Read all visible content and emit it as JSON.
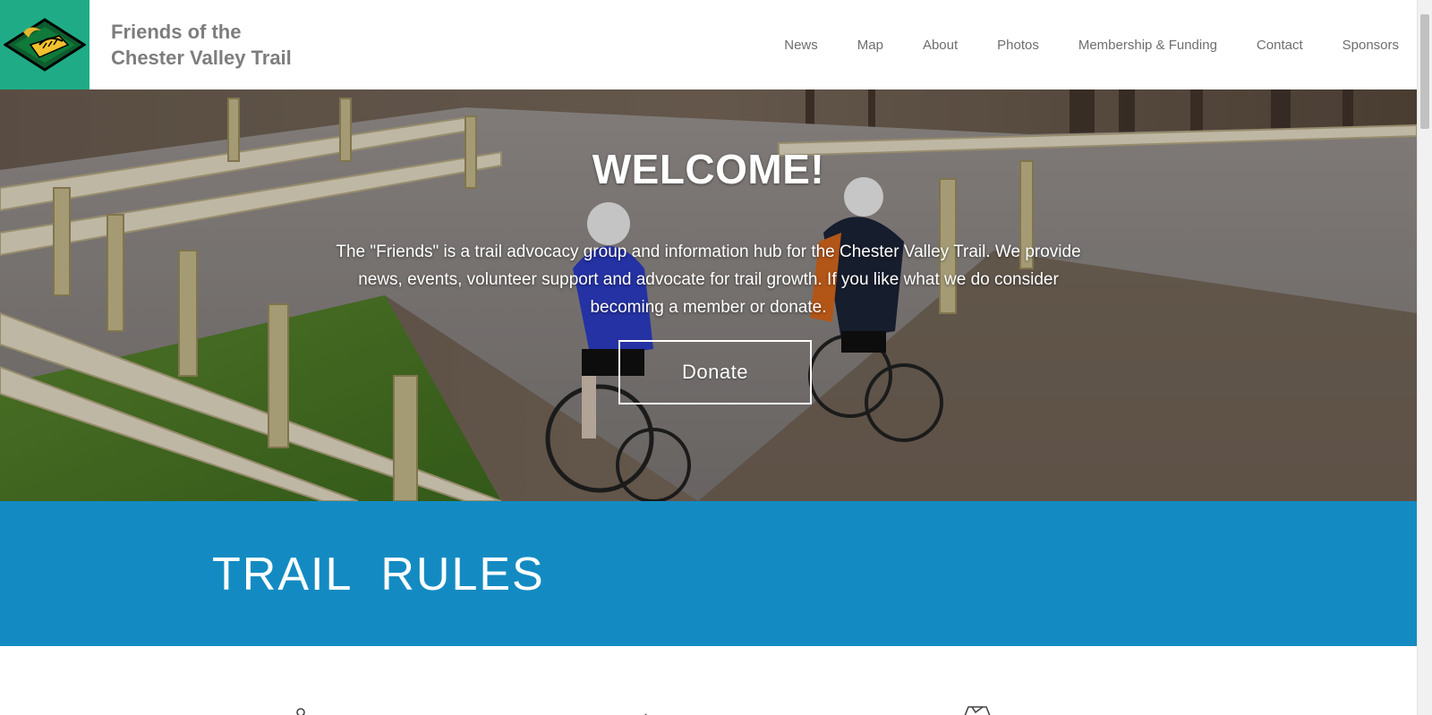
{
  "header": {
    "title_line1": "Friends of the",
    "title_line2": "Chester Valley Trail",
    "logo_icon": "trail-bridge-logo-icon",
    "brand_color": "#1fab85"
  },
  "nav": {
    "items": [
      {
        "label": "News"
      },
      {
        "label": "Map"
      },
      {
        "label": "About"
      },
      {
        "label": "Photos"
      },
      {
        "label": "Membership & Funding"
      },
      {
        "label": "Contact"
      },
      {
        "label": "Sponsors"
      }
    ]
  },
  "hero": {
    "title": "WELCOME!",
    "text": "The \"Friends\" is a trail advocacy group and information hub for the Chester Valley Trail. We provide news, events, volunteer support and advocate for trail growth. If you like what we do consider becoming a member or donate.",
    "donate_label": "Donate",
    "image_subject": "two cyclists riding on a paved trail beside a wooden fence"
  },
  "rules": {
    "title": "TRAIL  RULES",
    "band_color": "#138bc2"
  }
}
